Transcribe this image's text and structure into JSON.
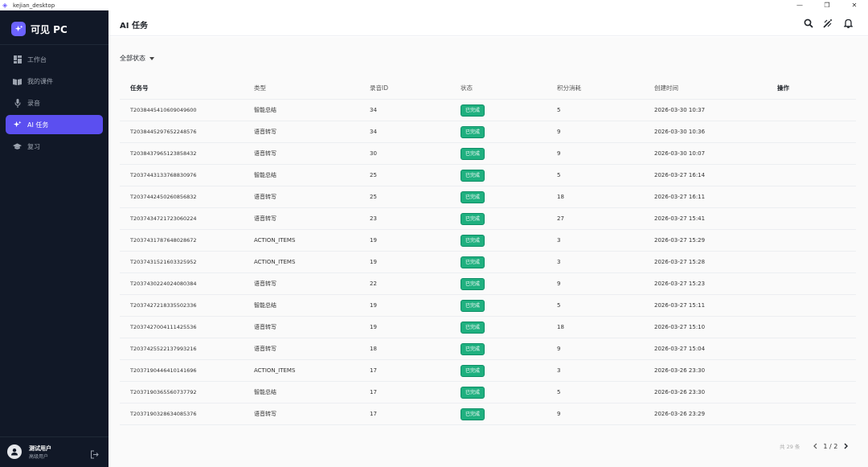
{
  "window": {
    "title": "kejian_desktop"
  },
  "brand": {
    "name": "可见 PC",
    "accent": "#6c63ff"
  },
  "sidebar": {
    "items": [
      {
        "label": "工作台",
        "icon": "dashboard-icon"
      },
      {
        "label": "我的课件",
        "icon": "book-icon"
      },
      {
        "label": "录音",
        "icon": "microphone-icon"
      },
      {
        "label": "AI 任务",
        "icon": "sparkle-icon",
        "active": true
      },
      {
        "label": "复习",
        "icon": "graduation-cap-icon"
      }
    ],
    "user": {
      "name": "测试用户",
      "role": "高级用户"
    }
  },
  "header": {
    "title": "AI 任务"
  },
  "filter": {
    "label": "全部状态"
  },
  "table": {
    "columns": [
      "任务号",
      "类型",
      "录音ID",
      "状态",
      "积分消耗",
      "创建时间",
      "操作"
    ],
    "rows": [
      [
        "T2038445410609049600",
        "智能总结",
        "34",
        "已完成",
        "5",
        "2026-03-30 10:37"
      ],
      [
        "T2038445297652248576",
        "语音转写",
        "34",
        "已完成",
        "9",
        "2026-03-30 10:36"
      ],
      [
        "T2038437965123858432",
        "语音转写",
        "30",
        "已完成",
        "9",
        "2026-03-30 10:07"
      ],
      [
        "T2037443133768830976",
        "智能总结",
        "25",
        "已完成",
        "5",
        "2026-03-27 16:14"
      ],
      [
        "T2037442450260856832",
        "语音转写",
        "25",
        "已完成",
        "18",
        "2026-03-27 16:11"
      ],
      [
        "T2037434721723060224",
        "语音转写",
        "23",
        "已完成",
        "27",
        "2026-03-27 15:41"
      ],
      [
        "T2037431787648028672",
        "ACTION_ITEMS",
        "19",
        "已完成",
        "3",
        "2026-03-27 15:29"
      ],
      [
        "T2037431521603325952",
        "ACTION_ITEMS",
        "19",
        "已完成",
        "3",
        "2026-03-27 15:28"
      ],
      [
        "T2037430224024080384",
        "语音转写",
        "22",
        "已完成",
        "9",
        "2026-03-27 15:23"
      ],
      [
        "T2037427218335502336",
        "智能总结",
        "19",
        "已完成",
        "5",
        "2026-03-27 15:11"
      ],
      [
        "T2037427004111425536",
        "语音转写",
        "19",
        "已完成",
        "18",
        "2026-03-27 15:10"
      ],
      [
        "T2037425522137993216",
        "语音转写",
        "18",
        "已完成",
        "9",
        "2026-03-27 15:04"
      ],
      [
        "T2037190446410141696",
        "ACTION_ITEMS",
        "17",
        "已完成",
        "3",
        "2026-03-26 23:30"
      ],
      [
        "T2037190365560737792",
        "智能总结",
        "17",
        "已完成",
        "5",
        "2026-03-26 23:30"
      ],
      [
        "T2037190328634085376",
        "语音转写",
        "17",
        "已完成",
        "9",
        "2026-03-26 23:29"
      ]
    ],
    "status_color": "#1fb07f"
  },
  "pagination": {
    "total_text": "共 29 条",
    "page_text": "1 / 2"
  }
}
